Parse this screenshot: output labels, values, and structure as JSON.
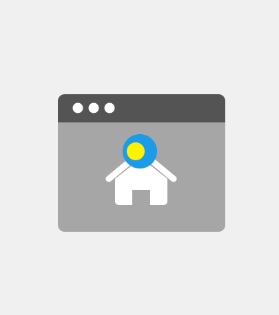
{
  "illustration": {
    "subject": "browser-window-home-location",
    "colors": {
      "background": "#f0f0f0",
      "window_body": "#a6a6a6",
      "title_bar": "#545454",
      "title_bar_dots": "#ffffff",
      "house": "#ffffff",
      "pin_outer": "#1b9be8",
      "pin_inner": "#fff200"
    },
    "icons": [
      "window-dot-icon",
      "home-icon",
      "location-pin-icon"
    ]
  }
}
